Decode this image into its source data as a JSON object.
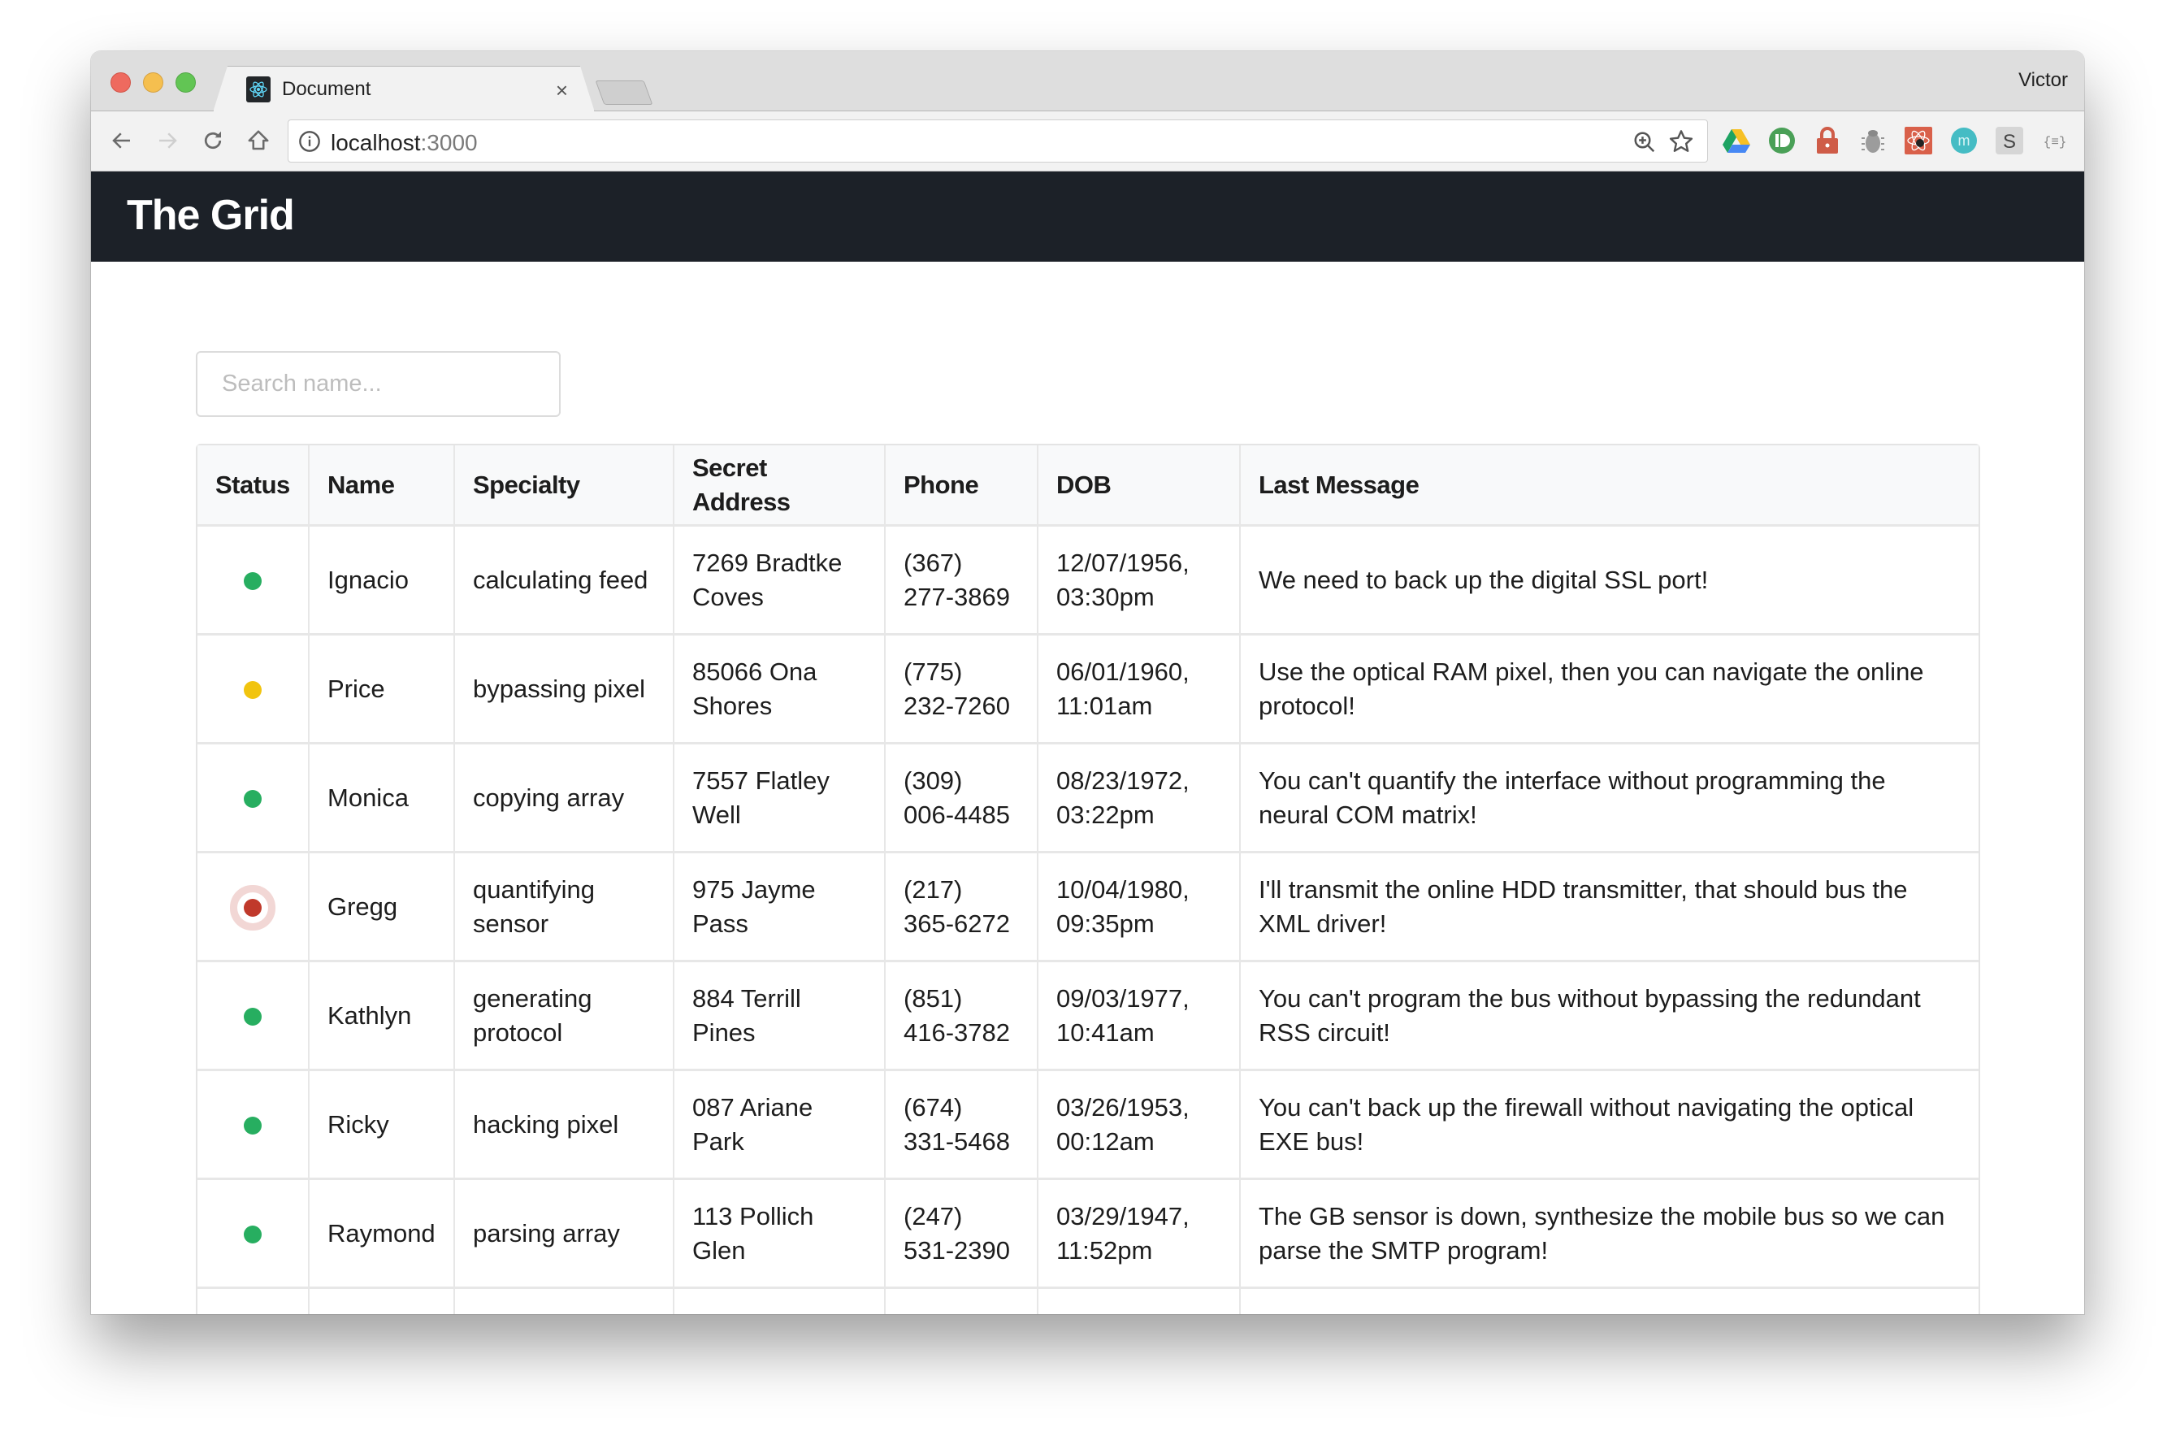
{
  "browser": {
    "tab_title": "Document",
    "tab_close": "×",
    "profile_name": "Victor",
    "url_host": "localhost",
    "url_port": ":3000",
    "extensions": [
      "google-drive-icon",
      "pushbullet-icon",
      "lock-icon",
      "bug-icon",
      "react-devtools-icon",
      "m-extension-icon",
      "s-extension-icon",
      "json-formatter-icon",
      "play-extension-icon"
    ]
  },
  "app": {
    "title": "The Grid",
    "search": {
      "placeholder": "Search name...",
      "value": ""
    }
  },
  "status_colors": {
    "online": "#27ae60",
    "away": "#f1c40f",
    "offline": "#c0392b"
  },
  "table": {
    "columns": [
      "Status",
      "Name",
      "Specialty",
      "Secret Address",
      "Phone",
      "DOB",
      "Last Message"
    ],
    "rows": [
      {
        "status": "online",
        "name": "Ignacio",
        "specialty": "calculating feed",
        "address": "7269 Bradtke Coves",
        "phone": "(367) 277-3869",
        "dob": "12/07/1956, 03:30pm",
        "message": "We need to back up the digital SSL port!"
      },
      {
        "status": "away",
        "name": "Price",
        "specialty": "bypassing pixel",
        "address": "85066 Ona Shores",
        "phone": "(775) 232-7260",
        "dob": "06/01/1960, 11:01am",
        "message": "Use the optical RAM pixel, then you can navigate the online protocol!"
      },
      {
        "status": "online",
        "name": "Monica",
        "specialty": "copying array",
        "address": "7557 Flatley Well",
        "phone": "(309) 006-4485",
        "dob": "08/23/1972, 03:22pm",
        "message": "You can't quantify the interface without programming the neural COM matrix!"
      },
      {
        "status": "offline",
        "name": "Gregg",
        "specialty": "quantifying sensor",
        "address": "975 Jayme Pass",
        "phone": "(217) 365-6272",
        "dob": "10/04/1980, 09:35pm",
        "message": "I'll transmit the online HDD transmitter, that should bus the XML driver!"
      },
      {
        "status": "online",
        "name": "Kathlyn",
        "specialty": "generating protocol",
        "address": "884 Terrill Pines",
        "phone": "(851) 416-3782",
        "dob": "09/03/1977, 10:41am",
        "message": "You can't program the bus without bypassing the redundant RSS circuit!"
      },
      {
        "status": "online",
        "name": "Ricky",
        "specialty": "hacking pixel",
        "address": "087 Ariane Park",
        "phone": "(674) 331-5468",
        "dob": "03/26/1953, 00:12am",
        "message": "You can't back up the firewall without navigating the optical EXE bus!"
      },
      {
        "status": "online",
        "name": "Raymond",
        "specialty": "parsing array",
        "address": "113 Pollich Glen",
        "phone": "(247) 531-2390",
        "dob": "03/29/1947, 11:52pm",
        "message": "The GB sensor is down, synthesize the mobile bus so we can parse the SMTP program!"
      }
    ]
  }
}
